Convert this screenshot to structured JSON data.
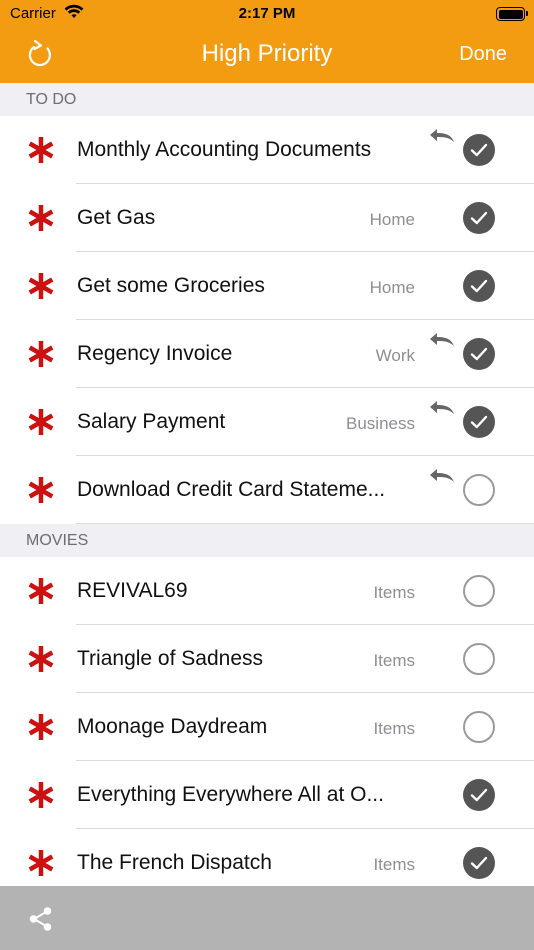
{
  "status_bar": {
    "carrier": "Carrier",
    "time": "2:17 PM"
  },
  "nav": {
    "title": "High Priority",
    "done_label": "Done",
    "accent_color": "#f39c12"
  },
  "sections": [
    {
      "header": "TO DO",
      "items": [
        {
          "title": "Monthly Accounting Documents",
          "tag": "",
          "repeat": true,
          "done": true
        },
        {
          "title": "Get Gas",
          "tag": "Home",
          "repeat": false,
          "done": true
        },
        {
          "title": "Get some Groceries",
          "tag": "Home",
          "repeat": false,
          "done": true
        },
        {
          "title": "Regency Invoice",
          "tag": "Work",
          "repeat": true,
          "done": true
        },
        {
          "title": "Salary Payment",
          "tag": "Business",
          "repeat": true,
          "done": true
        },
        {
          "title": "Download Credit Card Stateme...",
          "tag": "",
          "repeat": true,
          "done": false
        }
      ]
    },
    {
      "header": "MOVIES",
      "items": [
        {
          "title": "REVIVAL69",
          "tag": "Items",
          "repeat": false,
          "done": false
        },
        {
          "title": "Triangle of Sadness",
          "tag": "Items",
          "repeat": false,
          "done": false
        },
        {
          "title": "Moonage Daydream",
          "tag": "Items",
          "repeat": false,
          "done": false
        },
        {
          "title": "Everything Everywhere All at O...",
          "tag": "",
          "repeat": false,
          "done": true
        },
        {
          "title": "The French Dispatch",
          "tag": "Items",
          "repeat": false,
          "done": true
        }
      ]
    }
  ],
  "icons": {
    "priority": "asterisk-icon",
    "repeat": "undo-arrow-icon",
    "refresh": "refresh-icon",
    "share": "share-icon"
  },
  "colors": {
    "priority_star": "#cc1111",
    "checked": "#555555"
  }
}
